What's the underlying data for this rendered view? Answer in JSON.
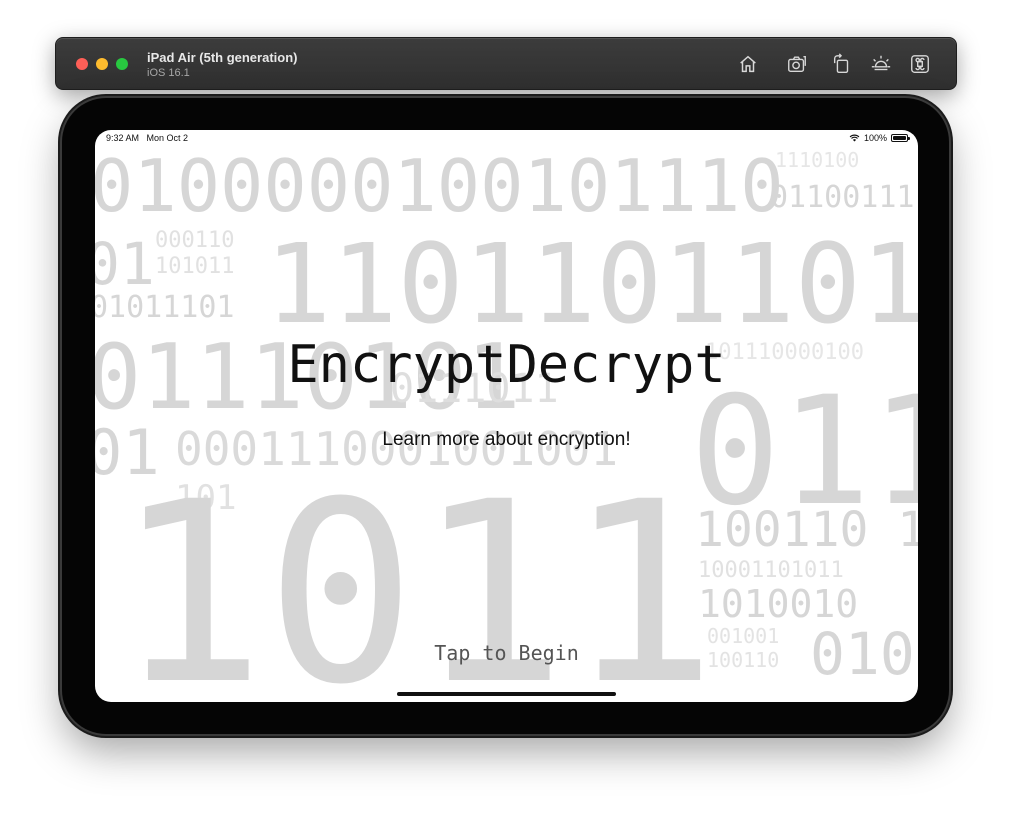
{
  "simulator": {
    "device_name": "iPad Air (5th generation)",
    "os_version": "iOS 16.1",
    "toolbar_icons": [
      "home-icon",
      "screenshot-icon",
      "rotate-icon",
      "appearance-icon",
      "command-icon"
    ]
  },
  "status_bar": {
    "time": "9:32 AM",
    "date": "Mon Oct 2",
    "battery": "100%"
  },
  "app": {
    "title": "EncryptDecrypt",
    "subtitle": "Learn more about encryption!",
    "begin_label": "Tap to Begin"
  },
  "background_binary": [
    "0100000100101110",
    "01100111",
    "1110100",
    "01",
    "000110",
    "101011",
    "1101101101",
    "01011101",
    "01110101",
    "0111011",
    "101110000100",
    "01",
    "0001110001001001",
    "011",
    "101",
    "1011",
    "100110 1",
    "10001101011",
    "1010010",
    "001001",
    "100110",
    "010"
  ],
  "colors": {
    "screen_bg": "#ffffff",
    "binary_text": "#d6d6d6",
    "title_text": "#111111",
    "begin_text": "#555555"
  }
}
